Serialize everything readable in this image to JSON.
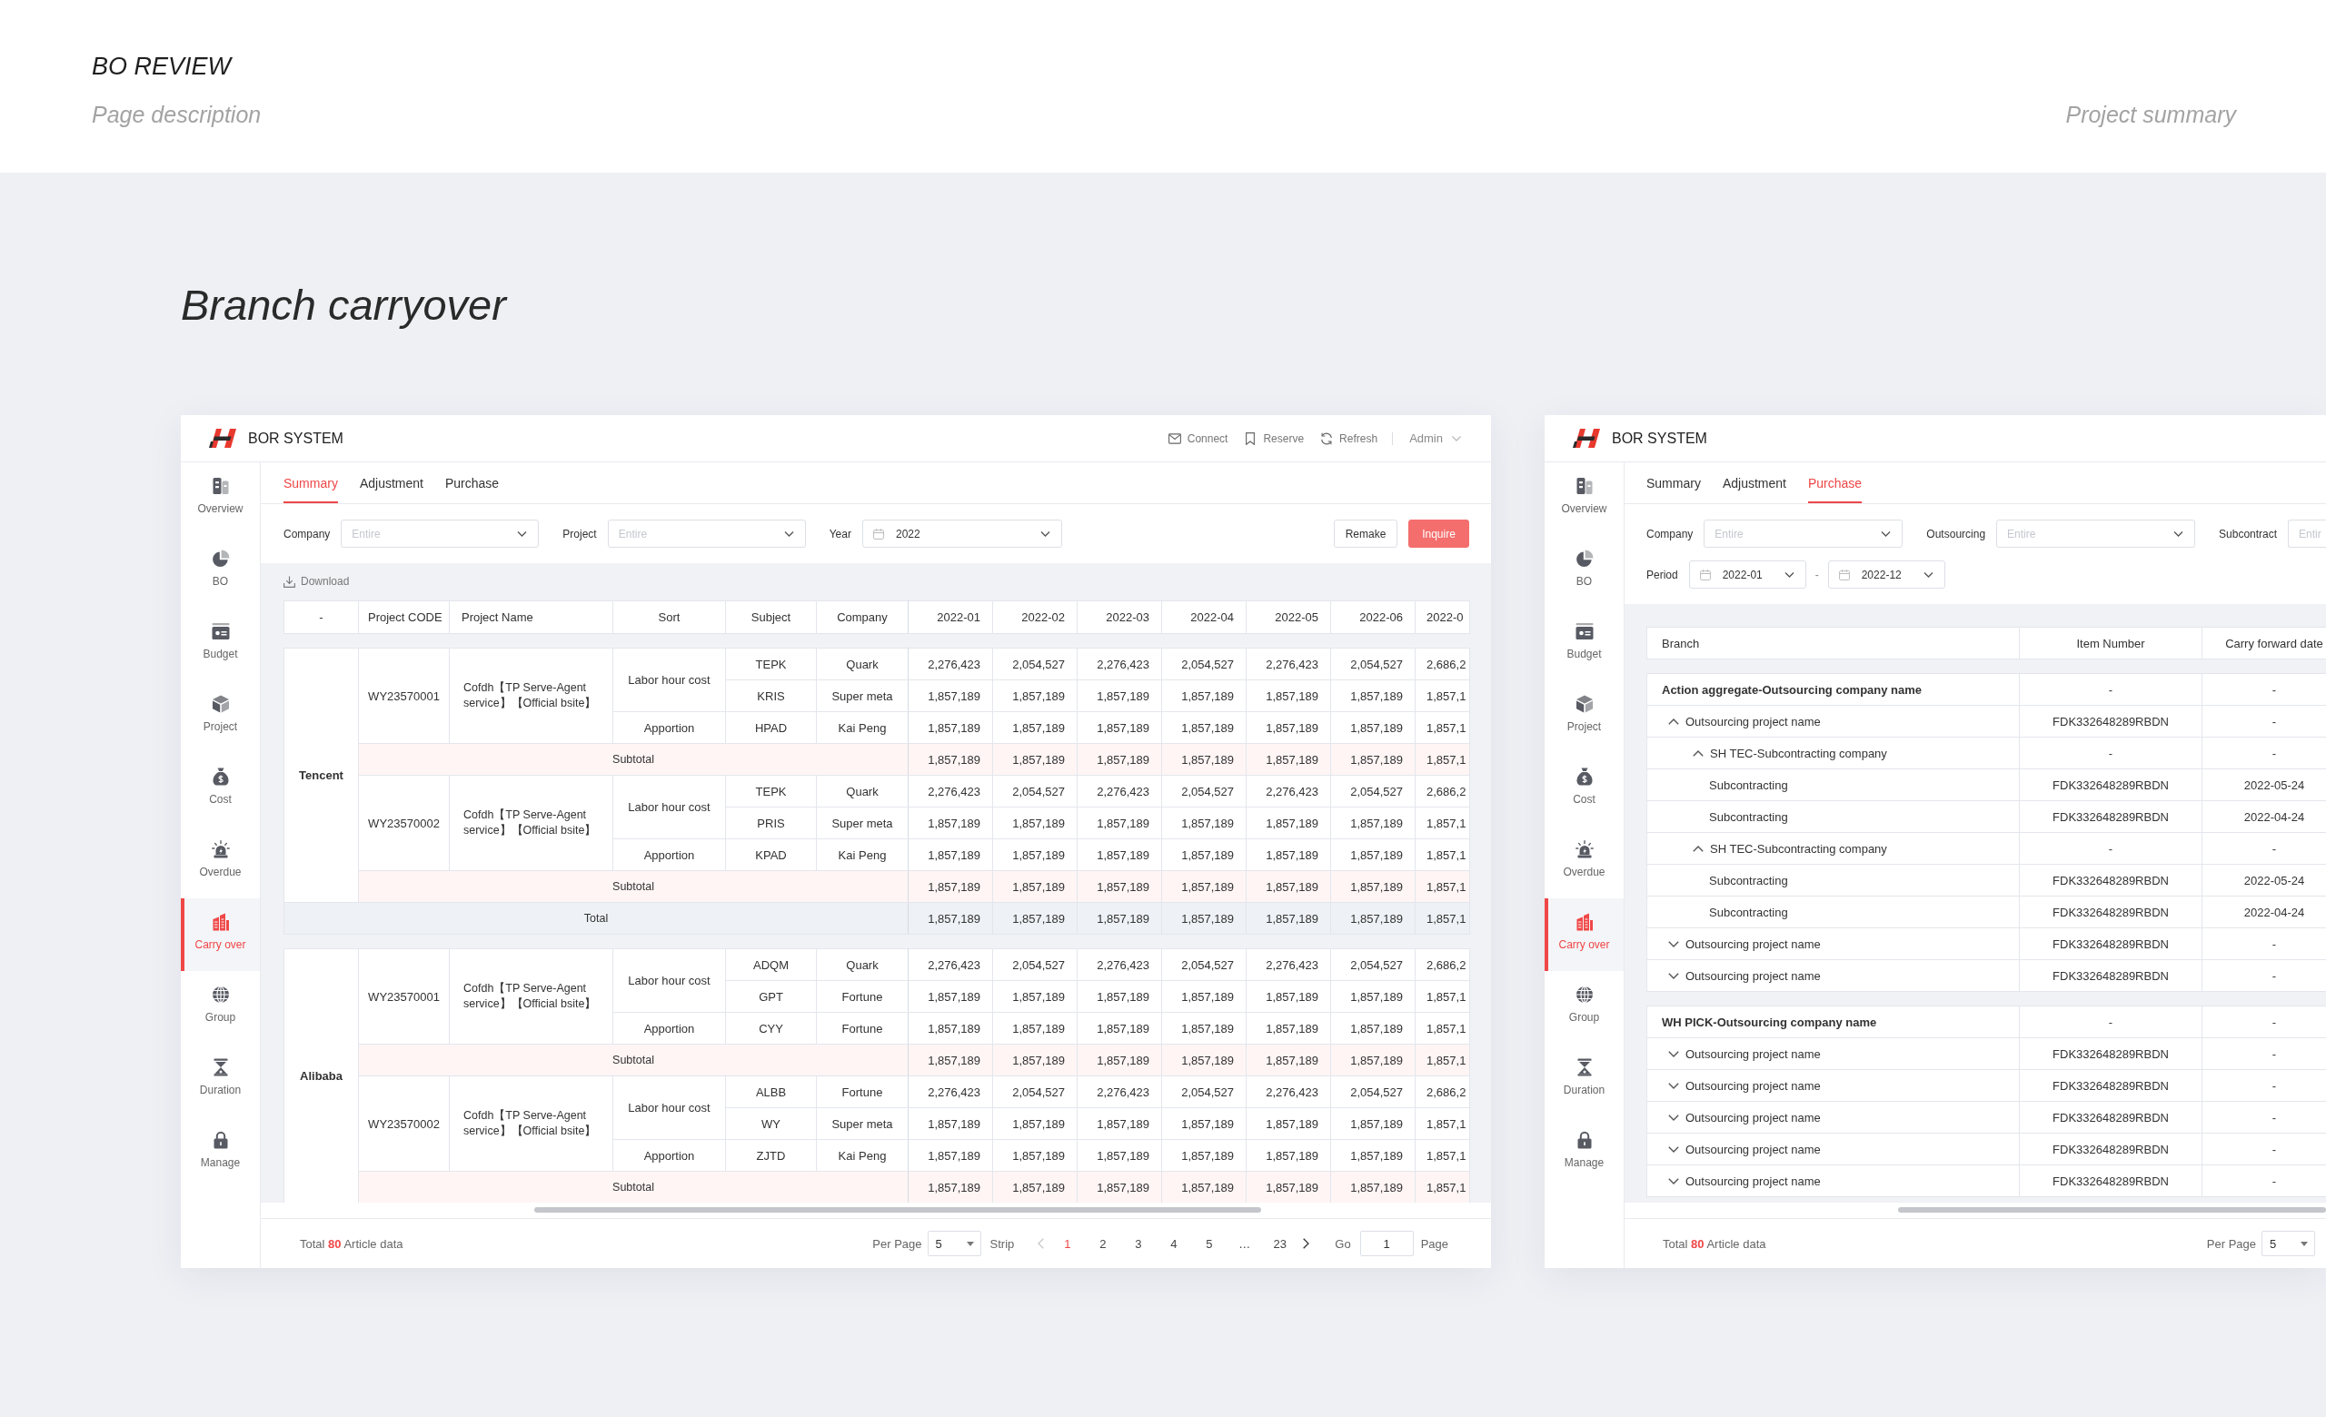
{
  "page": {
    "title": "BO REVIEW",
    "description": "Page description",
    "aside": "Project summary"
  },
  "section": {
    "title": "Branch carryover"
  },
  "screens": [
    {
      "kind": "summary",
      "header": {
        "title": "BOR SYSTEM",
        "actions": [
          {
            "label": "Connect"
          },
          {
            "label": "Reserve"
          },
          {
            "label": "Refresh"
          }
        ],
        "user": "Admin"
      },
      "sidebar": {
        "items": [
          {
            "label": "Overview",
            "selected": false
          },
          {
            "label": "BO",
            "selected": false
          },
          {
            "label": "Budget",
            "selected": false
          },
          {
            "label": "Project",
            "selected": false
          },
          {
            "label": "Cost",
            "selected": false
          },
          {
            "label": "Overdue",
            "selected": false
          },
          {
            "label": "Carry over",
            "selected": true
          },
          {
            "label": "Group",
            "selected": false
          },
          {
            "label": "Duration",
            "selected": false
          },
          {
            "label": "Manage",
            "selected": false
          }
        ]
      },
      "tabs": [
        {
          "label": "Summary",
          "selected": true
        },
        {
          "label": "Adjustment",
          "selected": false
        },
        {
          "label": "Purchase",
          "selected": false
        }
      ],
      "filter_rows": [
        [
          {
            "kind": "select",
            "label": "Company",
            "placeholder": "Entire"
          },
          {
            "kind": "select",
            "label": "Project",
            "placeholder": "Entire"
          },
          {
            "kind": "date",
            "label": "Year",
            "value": "2022"
          }
        ]
      ],
      "buttons": [
        {
          "kind": "secondary",
          "label": "Remake"
        },
        {
          "kind": "primary",
          "label": "Inquire"
        }
      ],
      "toolbar": {
        "download": "Download"
      },
      "table": {
        "columns": [
          "-",
          "Project CODE",
          "Project Name",
          "Sort",
          "Subject",
          "Company",
          "2022-01",
          "2022-02",
          "2022-03",
          "2022-04",
          "2022-05",
          "2022-06",
          "2022-0"
        ],
        "groups": [
          {
            "name": "Tencent",
            "projects": [
              {
                "code": "WY23570001",
                "name": "Cofdh【TP Serve-Agent service】【Official bsite】",
                "sorts": [
                  {
                    "name": "Labor hour cost",
                    "rows": [
                      {
                        "subject": "TEPK",
                        "company": "Quark",
                        "values": [
                          "2,276,423",
                          "2,054,527",
                          "2,276,423",
                          "2,054,527",
                          "2,276,423",
                          "2,054,527",
                          "2,686,2"
                        ]
                      },
                      {
                        "subject": "KRIS",
                        "company": "Super meta",
                        "values": [
                          "1,857,189",
                          "1,857,189",
                          "1,857,189",
                          "1,857,189",
                          "1,857,189",
                          "1,857,189",
                          "1,857,1"
                        ]
                      }
                    ]
                  },
                  {
                    "name": "Apportion",
                    "rows": [
                      {
                        "subject": "HPAD",
                        "company": "Kai Peng",
                        "values": [
                          "1,857,189",
                          "1,857,189",
                          "1,857,189",
                          "1,857,189",
                          "1,857,189",
                          "1,857,189",
                          "1,857,1"
                        ]
                      }
                    ]
                  }
                ],
                "subtotal": {
                  "label": "Subtotal",
                  "values": [
                    "1,857,189",
                    "1,857,189",
                    "1,857,189",
                    "1,857,189",
                    "1,857,189",
                    "1,857,189",
                    "1,857,1"
                  ]
                }
              },
              {
                "code": "WY23570002",
                "name": "Cofdh【TP Serve-Agent service】【Official bsite】",
                "sorts": [
                  {
                    "name": "Labor hour cost",
                    "rows": [
                      {
                        "subject": "TEPK",
                        "company": "Quark",
                        "values": [
                          "2,276,423",
                          "2,054,527",
                          "2,276,423",
                          "2,054,527",
                          "2,276,423",
                          "2,054,527",
                          "2,686,2"
                        ]
                      },
                      {
                        "subject": "PRIS",
                        "company": "Super meta",
                        "values": [
                          "1,857,189",
                          "1,857,189",
                          "1,857,189",
                          "1,857,189",
                          "1,857,189",
                          "1,857,189",
                          "1,857,1"
                        ]
                      }
                    ]
                  },
                  {
                    "name": "Apportion",
                    "rows": [
                      {
                        "subject": "KPAD",
                        "company": "Kai Peng",
                        "values": [
                          "1,857,189",
                          "1,857,189",
                          "1,857,189",
                          "1,857,189",
                          "1,857,189",
                          "1,857,189",
                          "1,857,1"
                        ]
                      }
                    ]
                  }
                ],
                "subtotal": {
                  "label": "Subtotal",
                  "values": [
                    "1,857,189",
                    "1,857,189",
                    "1,857,189",
                    "1,857,189",
                    "1,857,189",
                    "1,857,189",
                    "1,857,1"
                  ]
                }
              }
            ],
            "total": {
              "label": "Total",
              "values": [
                "1,857,189",
                "1,857,189",
                "1,857,189",
                "1,857,189",
                "1,857,189",
                "1,857,189",
                "1,857,1"
              ]
            }
          },
          {
            "name": "Alibaba",
            "projects": [
              {
                "code": "WY23570001",
                "name": "Cofdh【TP Serve-Agent service】【Official bsite】",
                "sorts": [
                  {
                    "name": "Labor hour cost",
                    "rows": [
                      {
                        "subject": "ADQM",
                        "company": "Quark",
                        "values": [
                          "2,276,423",
                          "2,054,527",
                          "2,276,423",
                          "2,054,527",
                          "2,276,423",
                          "2,054,527",
                          "2,686,2"
                        ]
                      },
                      {
                        "subject": "GPT",
                        "company": "Fortune",
                        "values": [
                          "1,857,189",
                          "1,857,189",
                          "1,857,189",
                          "1,857,189",
                          "1,857,189",
                          "1,857,189",
                          "1,857,1"
                        ]
                      }
                    ]
                  },
                  {
                    "name": "Apportion",
                    "rows": [
                      {
                        "subject": "CYY",
                        "company": "Fortune",
                        "values": [
                          "1,857,189",
                          "1,857,189",
                          "1,857,189",
                          "1,857,189",
                          "1,857,189",
                          "1,857,189",
                          "1,857,1"
                        ]
                      }
                    ]
                  }
                ],
                "subtotal": {
                  "label": "Subtotal",
                  "values": [
                    "1,857,189",
                    "1,857,189",
                    "1,857,189",
                    "1,857,189",
                    "1,857,189",
                    "1,857,189",
                    "1,857,1"
                  ]
                }
              },
              {
                "code": "WY23570002",
                "name": "Cofdh【TP Serve-Agent service】【Official bsite】",
                "sorts": [
                  {
                    "name": "Labor hour cost",
                    "rows": [
                      {
                        "subject": "ALBB",
                        "company": "Fortune",
                        "values": [
                          "2,276,423",
                          "2,054,527",
                          "2,276,423",
                          "2,054,527",
                          "2,276,423",
                          "2,054,527",
                          "2,686,2"
                        ]
                      },
                      {
                        "subject": "WY",
                        "company": "Super meta",
                        "values": [
                          "1,857,189",
                          "1,857,189",
                          "1,857,189",
                          "1,857,189",
                          "1,857,189",
                          "1,857,189",
                          "1,857,1"
                        ]
                      }
                    ]
                  },
                  {
                    "name": "Apportion",
                    "rows": [
                      {
                        "subject": "ZJTD",
                        "company": "Kai Peng",
                        "values": [
                          "1,857,189",
                          "1,857,189",
                          "1,857,189",
                          "1,857,189",
                          "1,857,189",
                          "1,857,189",
                          "1,857,1"
                        ]
                      }
                    ]
                  }
                ],
                "subtotal": {
                  "label": "Subtotal",
                  "values": [
                    "1,857,189",
                    "1,857,189",
                    "1,857,189",
                    "1,857,189",
                    "1,857,189",
                    "1,857,189",
                    "1,857,1"
                  ]
                }
              }
            ]
          }
        ]
      },
      "pagination": {
        "total": "Total **80** Article data",
        "per_page_label": "Per Page",
        "per_page": "5",
        "unit": "Strip",
        "prev": {
          "disabled": true
        },
        "pages": [
          {
            "label": "1",
            "selected": true
          },
          {
            "label": "2",
            "selected": false
          },
          {
            "label": "3",
            "selected": false
          },
          {
            "label": "4",
            "selected": false
          },
          {
            "label": "5",
            "selected": false
          },
          {
            "label": "…",
            "selected": false
          },
          {
            "label": "23",
            "selected": false
          }
        ],
        "next": {
          "disabled": false
        },
        "go_label": "Go",
        "go_value": "1",
        "page_label": "Page"
      }
    },
    {
      "kind": "purchase",
      "header": {
        "title": "BOR SYSTEM"
      },
      "sidebar": {
        "items": [
          {
            "label": "Overview",
            "selected": false
          },
          {
            "label": "BO",
            "selected": false
          },
          {
            "label": "Budget",
            "selected": false
          },
          {
            "label": "Project",
            "selected": false
          },
          {
            "label": "Cost",
            "selected": false
          },
          {
            "label": "Overdue",
            "selected": false
          },
          {
            "label": "Carry over",
            "selected": true
          },
          {
            "label": "Group",
            "selected": false
          },
          {
            "label": "Duration",
            "selected": false
          },
          {
            "label": "Manage",
            "selected": false
          }
        ]
      },
      "tabs": [
        {
          "label": "Summary",
          "selected": false
        },
        {
          "label": "Adjustment",
          "selected": false
        },
        {
          "label": "Purchase",
          "selected": true
        }
      ],
      "filter_rows": [
        [
          {
            "kind": "select",
            "label": "Company",
            "placeholder": "Entire"
          },
          {
            "kind": "select",
            "label": "Outsourcing",
            "placeholder": "Entire"
          },
          {
            "kind": "cut",
            "label": "Subcontract",
            "placeholder": "Entir"
          }
        ],
        [
          {
            "kind": "range",
            "label": "Period",
            "from": "2022-01",
            "separator": "-",
            "to": "2022-12"
          }
        ]
      ],
      "table": {
        "columns": [
          "Branch",
          "Item Number",
          "Carry forward date"
        ],
        "groups": [
          {
            "name": "Action aggregate-Outsourcing company name",
            "item_number": "-",
            "date": "-",
            "children": [
              {
                "name": "Outsourcing project name",
                "item_number": "FDK332648289RBDN",
                "date": "-",
                "expanded": true,
                "children": [
                  {
                    "name": "SH TEC-Subcontracting company",
                    "item_number": "-",
                    "date": "-",
                    "expanded": true,
                    "children": [
                      {
                        "name": "Subcontracting",
                        "item_number": "FDK332648289RBDN",
                        "date": "2022-05-24"
                      },
                      {
                        "name": "Subcontracting",
                        "item_number": "FDK332648289RBDN",
                        "date": "2022-04-24"
                      }
                    ]
                  },
                  {
                    "name": "SH TEC-Subcontracting company",
                    "item_number": "-",
                    "date": "-",
                    "expanded": true,
                    "children": [
                      {
                        "name": "Subcontracting",
                        "item_number": "FDK332648289RBDN",
                        "date": "2022-05-24"
                      },
                      {
                        "name": "Subcontracting",
                        "item_number": "FDK332648289RBDN",
                        "date": "2022-04-24"
                      }
                    ]
                  }
                ]
              },
              {
                "name": "Outsourcing project name",
                "item_number": "FDK332648289RBDN",
                "date": "-",
                "expanded": false
              },
              {
                "name": "Outsourcing project name",
                "item_number": "FDK332648289RBDN",
                "date": "-",
                "expanded": false
              }
            ]
          },
          {
            "name": "WH PICK-Outsourcing company name",
            "item_number": "-",
            "date": "-",
            "children": [
              {
                "name": "Outsourcing project name",
                "item_number": "FDK332648289RBDN",
                "date": "-",
                "expanded": false
              },
              {
                "name": "Outsourcing project name",
                "item_number": "FDK332648289RBDN",
                "date": "-",
                "expanded": false
              },
              {
                "name": "Outsourcing project name",
                "item_number": "FDK332648289RBDN",
                "date": "-",
                "expanded": false
              },
              {
                "name": "Outsourcing project name",
                "item_number": "FDK332648289RBDN",
                "date": "-",
                "expanded": false
              },
              {
                "name": "Outsourcing project name",
                "item_number": "FDK332648289RBDN",
                "date": "-",
                "expanded": false
              }
            ]
          }
        ]
      },
      "pagination": {
        "total": "Total **80** Article data",
        "per_page_label": "Per Page",
        "per_page": "5"
      }
    }
  ]
}
